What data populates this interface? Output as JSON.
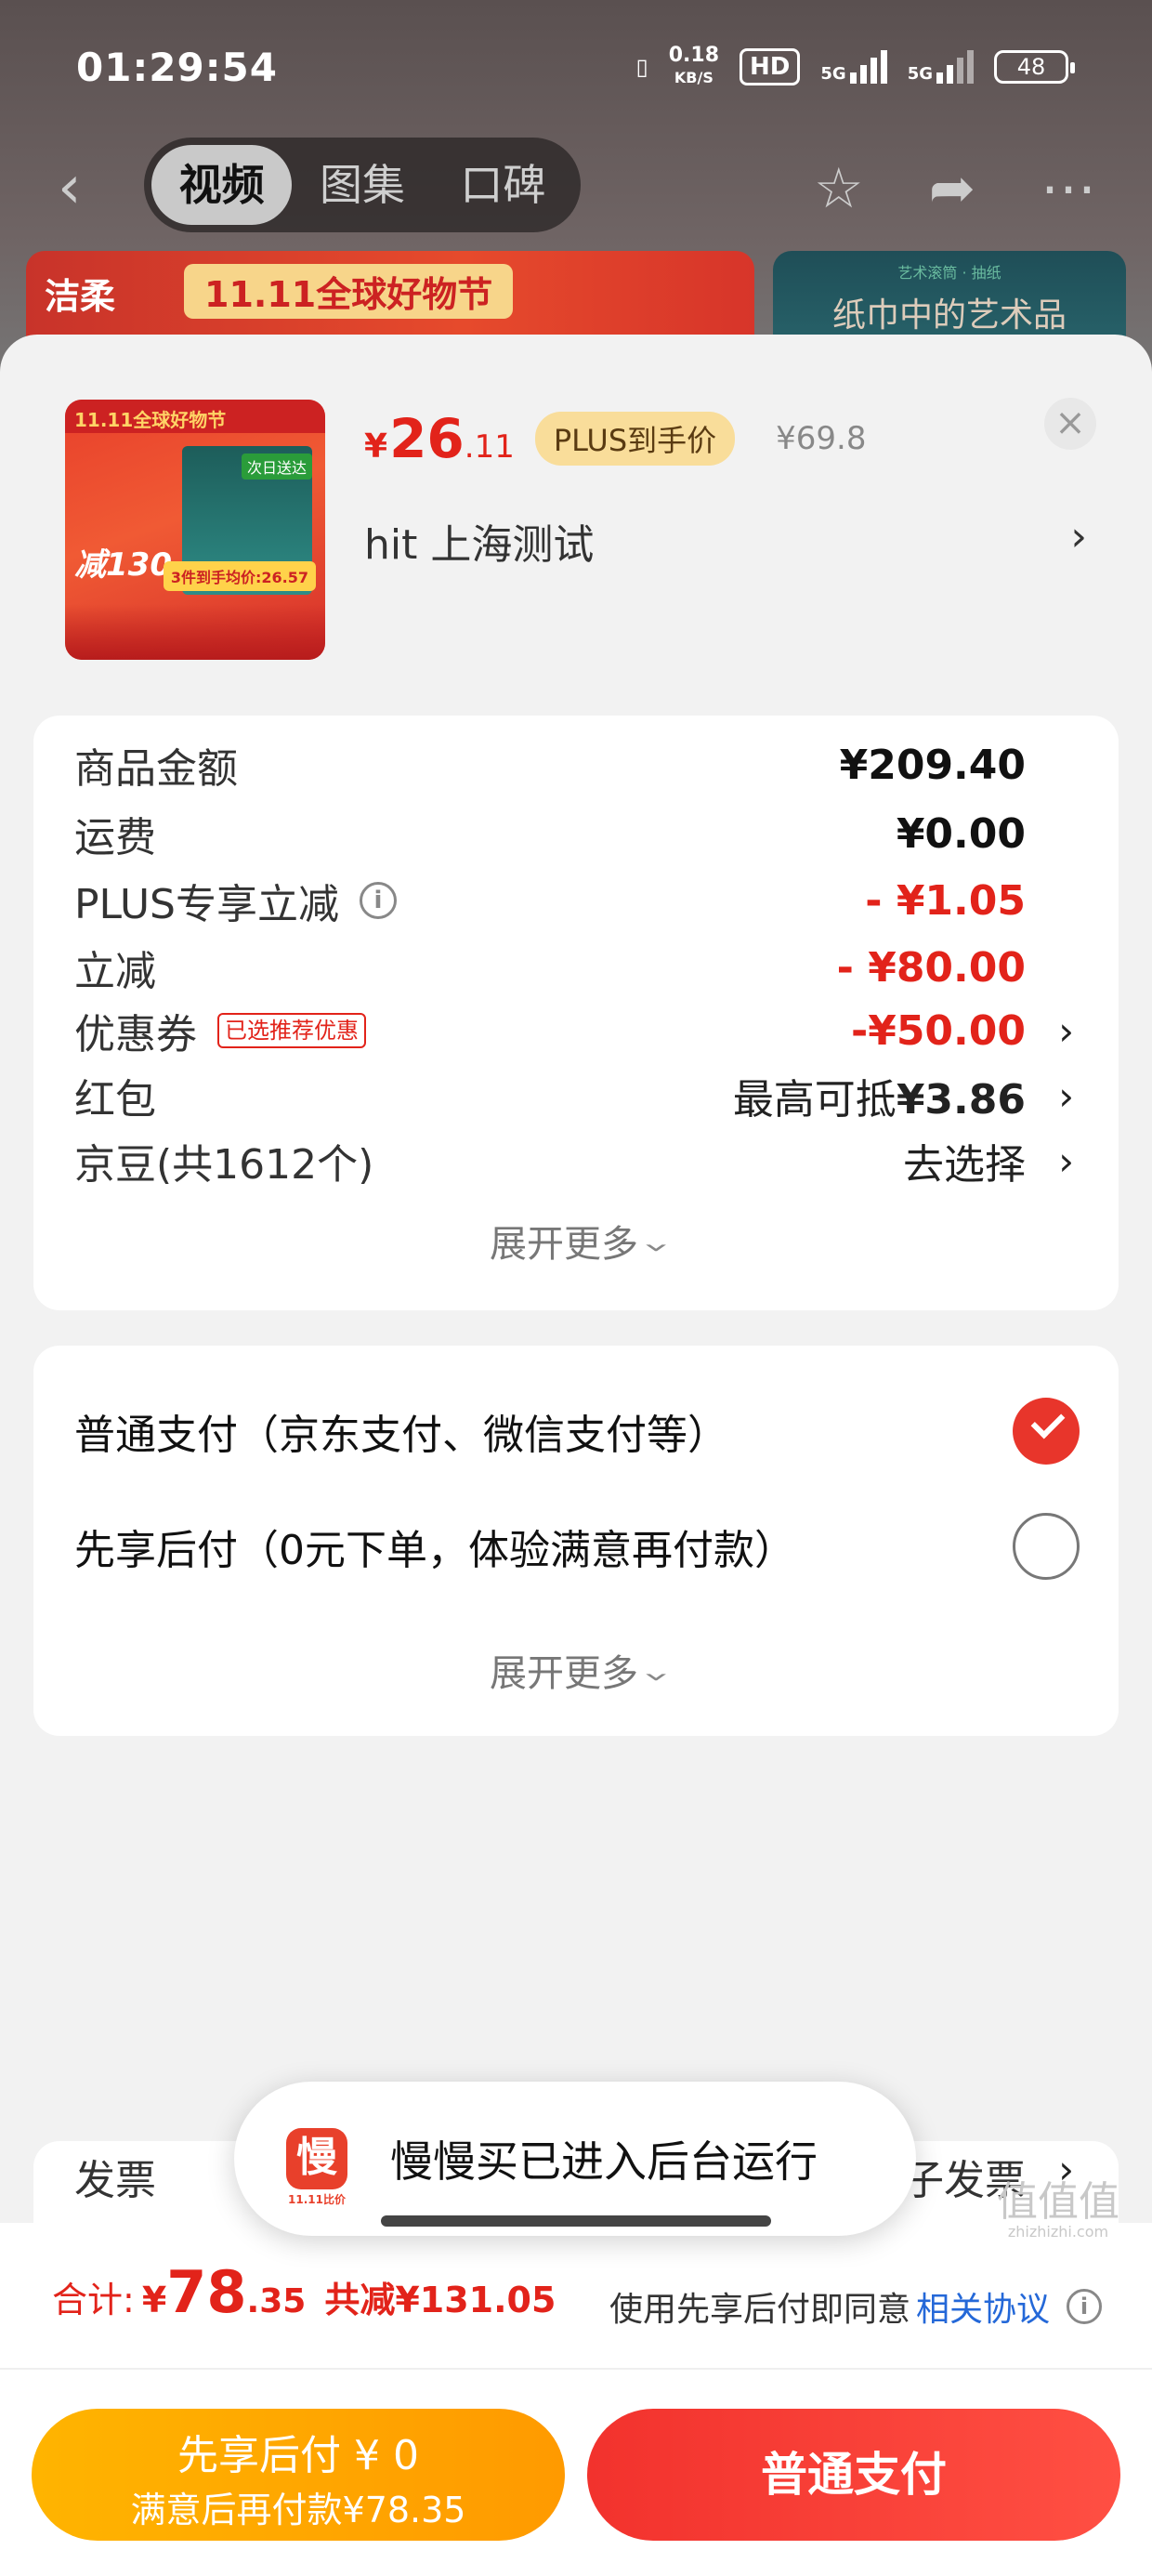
{
  "status_bar": {
    "time": "01:29:54",
    "speed_value": "0.18",
    "speed_unit": "KB/S",
    "hd": "HD",
    "net1": "5G",
    "net2": "5G",
    "battery": "48"
  },
  "top_nav": {
    "tabs": [
      {
        "label": "视频",
        "active": true
      },
      {
        "label": "图集",
        "active": false
      },
      {
        "label": "口碑",
        "active": false
      }
    ]
  },
  "background_banners": {
    "left_brand": "洁柔",
    "left_title": "11.11全球好物节",
    "right_subtitle": "艺术滚筒 · 抽纸",
    "right_title": "纸巾中的艺术品"
  },
  "product": {
    "price_yen": "¥",
    "price_int": "26",
    "price_dec": ".11",
    "plus_tag": "PLUS到手价",
    "original_price": "¥69.8",
    "address": "hit  上海测试",
    "thumb": {
      "top": "11.11全球好物节",
      "big": "减130",
      "badge": "次日送达",
      "price": "3件到手均价:26.57"
    }
  },
  "summary": {
    "rows": [
      {
        "label": "商品金额",
        "value": "¥209.40"
      },
      {
        "label": "运费",
        "value": "¥0.00"
      },
      {
        "label": "PLUS专享立减",
        "value": "- ¥1.05"
      },
      {
        "label": "立减",
        "value": "- ¥80.00"
      },
      {
        "label": "优惠券",
        "tag": "已选推荐优惠",
        "value": "-¥50.00"
      },
      {
        "label": "红包",
        "value_prefix": "最高可抵",
        "value": "¥3.86"
      },
      {
        "label": "京豆(共1612个)",
        "value": "去选择"
      }
    ],
    "expand": "展开更多"
  },
  "payment": {
    "options": [
      {
        "label": "普通支付（京东支付、微信支付等）",
        "checked": true
      },
      {
        "label": "先享后付（0元下单，体验满意再付款）",
        "checked": false
      }
    ],
    "expand": "展开更多"
  },
  "invoice": {
    "label": "发票",
    "value": "电子发票"
  },
  "toast": {
    "logo": "慢",
    "logo_sub": "11.11比价",
    "text": "慢慢买已进入后台运行"
  },
  "footer": {
    "total_label": "合计:",
    "total_yen": "¥",
    "total_int": "78",
    "total_dec": ".35",
    "total_saved": "共减¥131.05",
    "agree_text": "使用先享后付即同意",
    "agree_link": "相关协议",
    "btn_later_main": "先享后付 ¥ 0",
    "btn_later_sub": "满意后再付款¥78.35",
    "btn_pay": "普通支付"
  },
  "watermark": {
    "main": "值值值",
    "sub": "zhizhizhi.com"
  },
  "colors": {
    "accent_red": "#e2231a",
    "plus_gold": "#f9dd9a",
    "later_orange": "#ffa800",
    "link_blue": "#2468d8"
  }
}
